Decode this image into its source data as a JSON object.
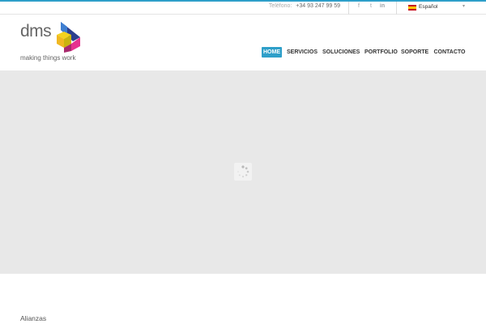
{
  "topbar": {
    "phone_label": "Teléfono:",
    "phone_number": "+34 93 247 99 59",
    "social": {
      "facebook": "f",
      "twitter": "t",
      "linkedin": "in"
    },
    "language": "Español"
  },
  "logo": {
    "wordmark": "dms",
    "tagline": "making things work"
  },
  "nav": {
    "items": [
      "HOME",
      "SERVICIOS",
      "SOLUCIONES",
      "PORTFOLIO",
      "SOPORTE",
      "CONTACTO"
    ],
    "active": "HOME"
  },
  "sections": {
    "alliances_title": "Alianzas"
  },
  "colors": {
    "accent": "#2e9fc9",
    "slider_bg": "#e8e8e8"
  }
}
